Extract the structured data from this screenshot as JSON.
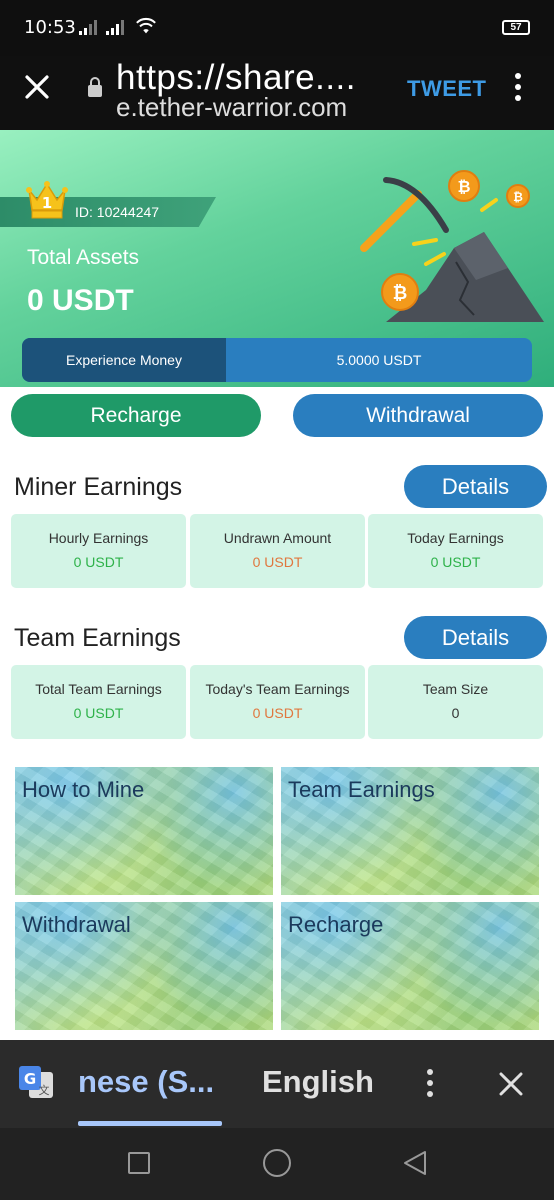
{
  "status_bar": {
    "time": "10:53",
    "battery": "57"
  },
  "browser": {
    "url_main": "https://share....",
    "url_sub": "e.tether-warrior.com",
    "tweet_label": "TWEET"
  },
  "hero": {
    "rank": "1",
    "id_text": "ID: 10244247",
    "total_assets_label": "Total Assets",
    "total_assets_value": "0 USDT",
    "experience_label": "Experience Money",
    "experience_value": "5.0000 USDT"
  },
  "actions": {
    "recharge_label": "Recharge",
    "withdrawal_label": "Withdrawal"
  },
  "miner": {
    "title": "Miner Earnings",
    "details_label": "Details",
    "stats": [
      {
        "label": "Hourly Earnings",
        "value": "0 USDT"
      },
      {
        "label": "Undrawn Amount",
        "value": "0 USDT"
      },
      {
        "label": "Today Earnings",
        "value": "0 USDT"
      }
    ]
  },
  "team": {
    "title": "Team Earnings",
    "details_label": "Details",
    "stats": [
      {
        "label": "Total Team Earnings",
        "value": "0 USDT"
      },
      {
        "label": "Today's Team Earnings",
        "value": "0 USDT"
      },
      {
        "label": "Team Size",
        "value": "0"
      }
    ]
  },
  "tiles": [
    {
      "label": "How to Mine"
    },
    {
      "label": "Team Earnings"
    },
    {
      "label": "Withdrawal"
    },
    {
      "label": "Recharge"
    }
  ],
  "translate": {
    "source_lang": "nese (S...",
    "target_lang": "English"
  },
  "colors": {
    "accent_green": "#1f9a68",
    "accent_blue": "#2a7ebf",
    "value_green": "#2eb24a",
    "value_orange": "#e0773e",
    "card_bg": "#d3f4e6"
  }
}
